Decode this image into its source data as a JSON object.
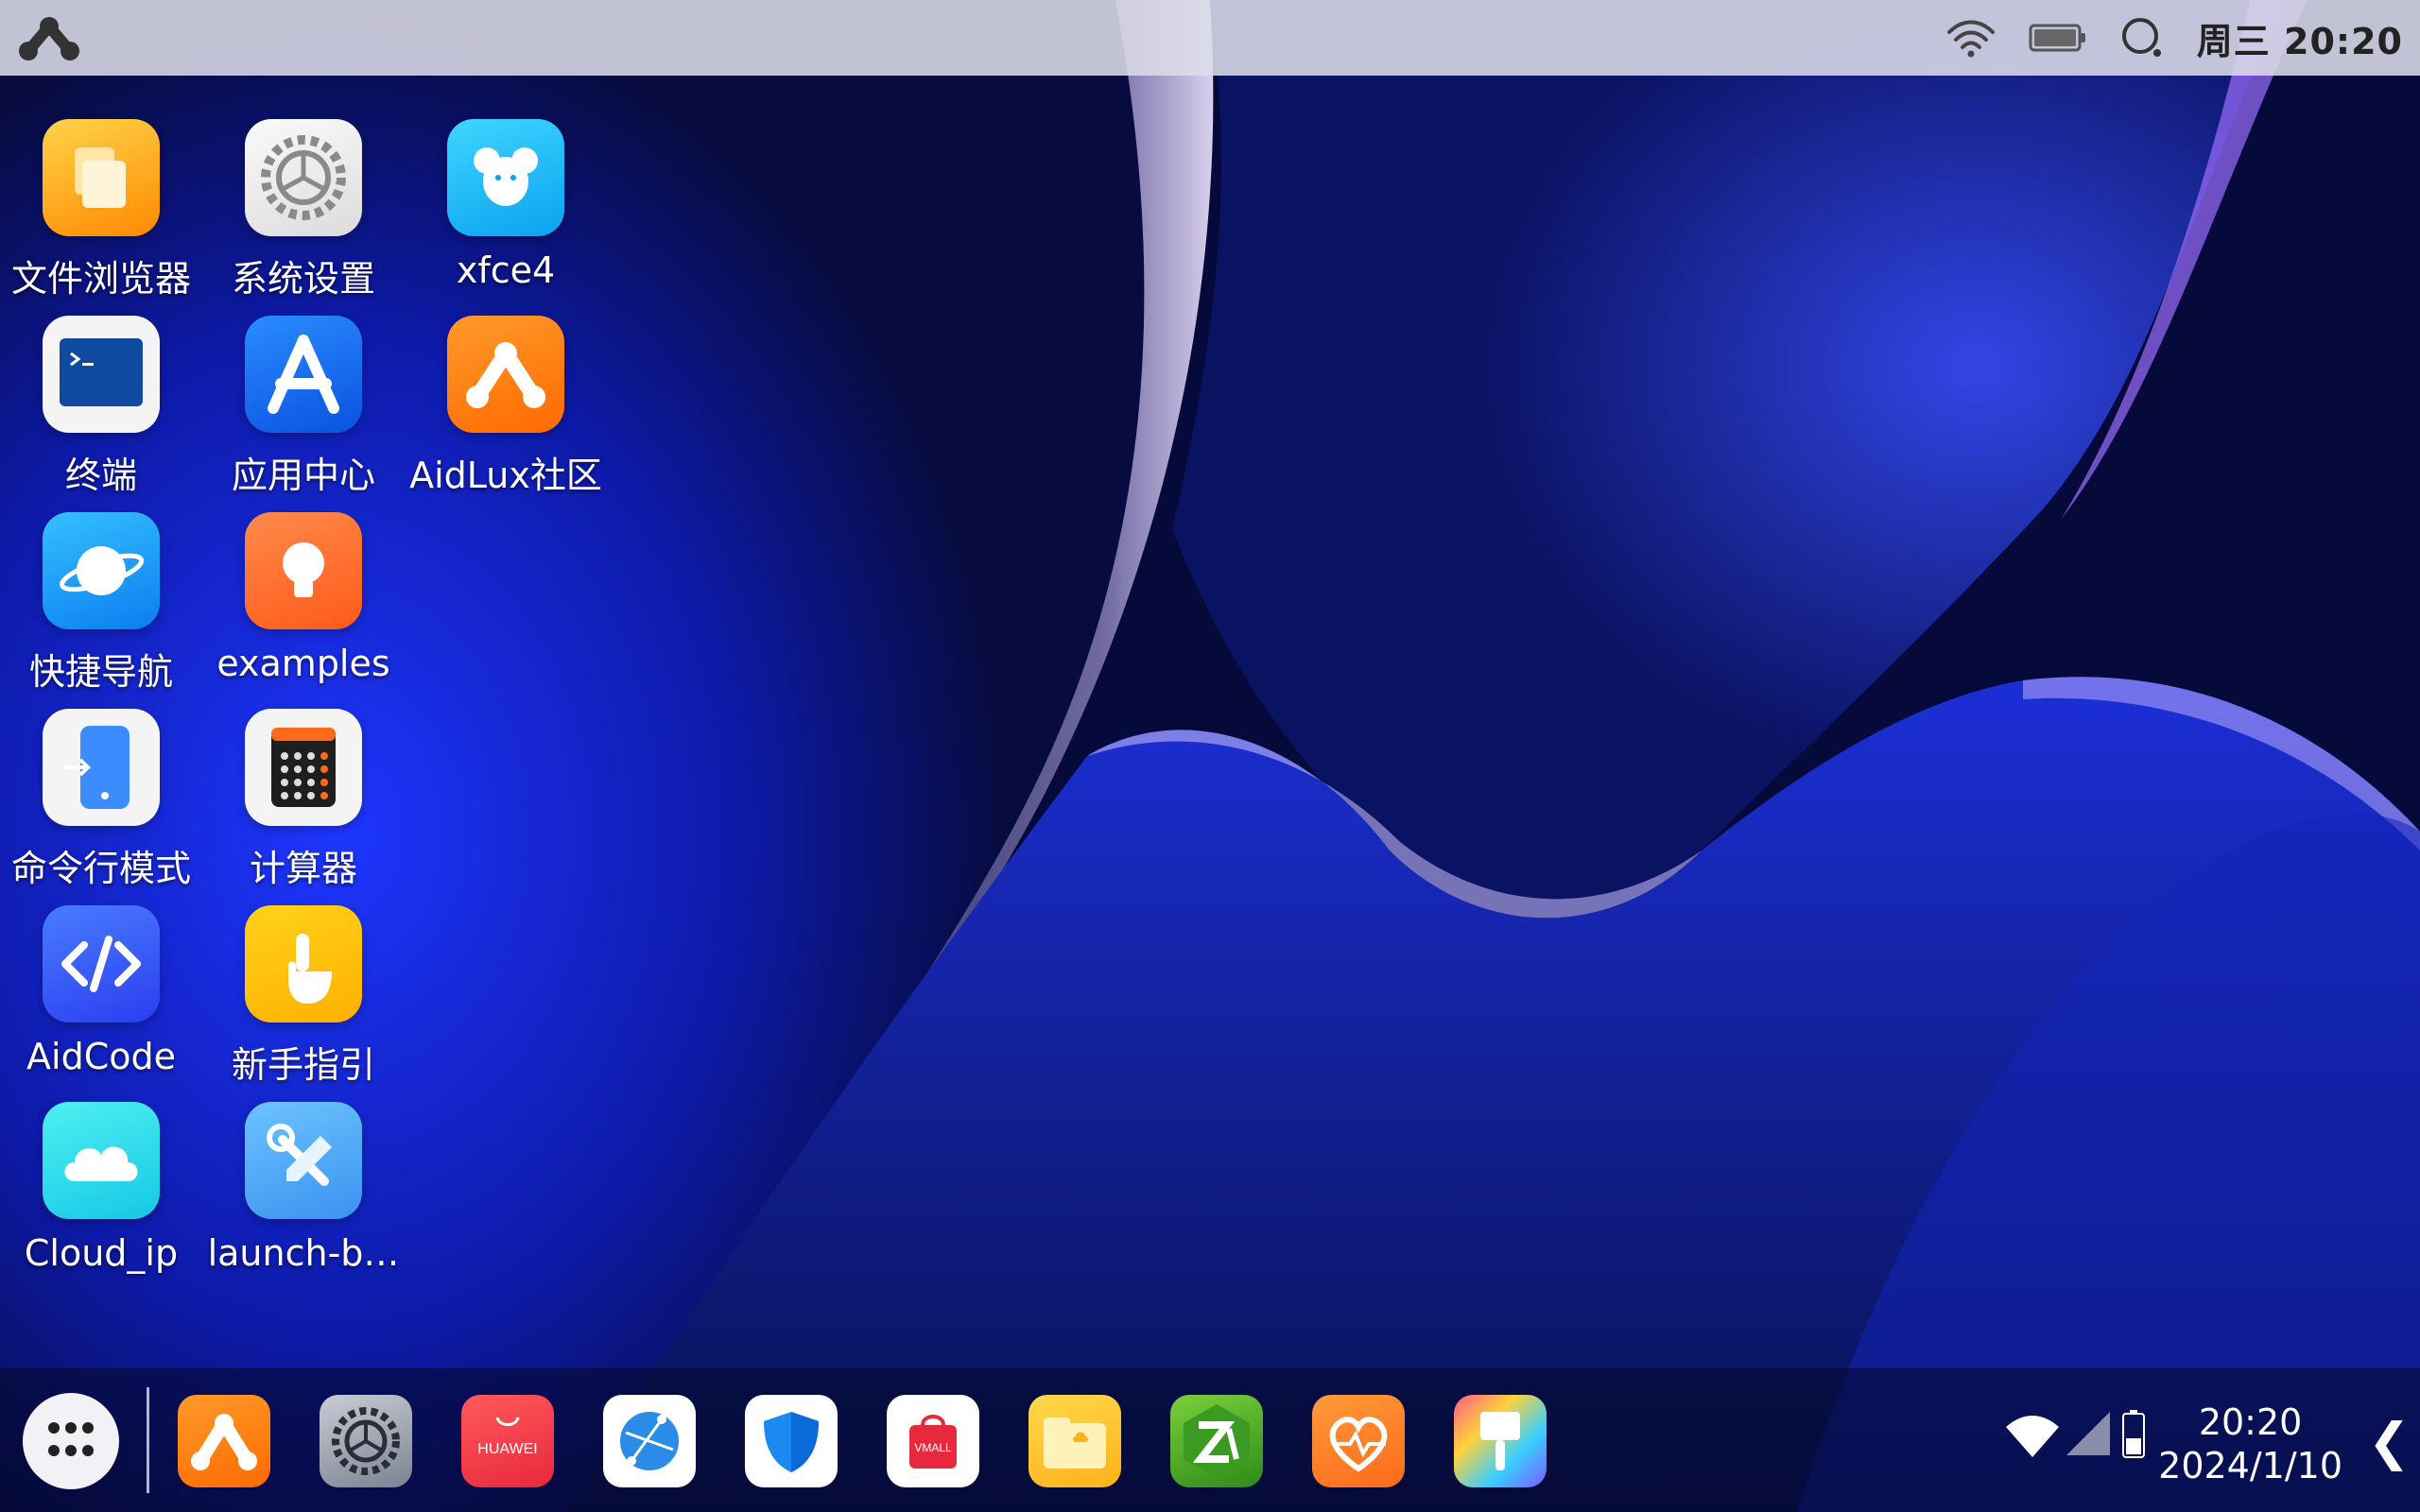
{
  "topbar": {
    "clock": "周三 20:20"
  },
  "desktop": {
    "icons": [
      {
        "label": "文件浏览器",
        "icon": "folder-icon"
      },
      {
        "label": "系统设置",
        "icon": "gear-icon"
      },
      {
        "label": "xfce4",
        "icon": "mouse-icon"
      },
      {
        "label": "终端",
        "icon": "terminal-icon"
      },
      {
        "label": "应用中心",
        "icon": "app-store-icon"
      },
      {
        "label": "AidLux社区",
        "icon": "aidlux-logo-icon"
      },
      {
        "label": "快捷导航",
        "icon": "planet-icon"
      },
      {
        "label": "examples",
        "icon": "lightbulb-icon"
      },
      {
        "label": "命令行模式",
        "icon": "phone-terminal-icon"
      },
      {
        "label": "计算器",
        "icon": "calculator-icon"
      },
      {
        "label": "AidCode",
        "icon": "code-icon"
      },
      {
        "label": "新手指引",
        "icon": "hand-pointer-icon"
      },
      {
        "label": "Cloud_ip",
        "icon": "cloud-icon"
      },
      {
        "label": "launch-b…",
        "icon": "tools-icon"
      }
    ]
  },
  "dock": {
    "apps": [
      {
        "name": "aidlux",
        "icon": "aidlux-logo-icon"
      },
      {
        "name": "settings",
        "icon": "gear-icon"
      },
      {
        "name": "huawei",
        "text": "HUAWEI",
        "icon": "huawei-store-icon"
      },
      {
        "name": "browser",
        "icon": "globe-icon"
      },
      {
        "name": "security",
        "icon": "shield-icon"
      },
      {
        "name": "vmall",
        "text": "VMALL",
        "icon": "shopping-bag-icon"
      },
      {
        "name": "files",
        "icon": "folder-icon"
      },
      {
        "name": "zarchiver",
        "icon": "archive-icon"
      },
      {
        "name": "health",
        "icon": "heart-icon"
      },
      {
        "name": "themes",
        "icon": "paintbrush-icon"
      }
    ],
    "time": "20:20",
    "date": "2024/1/10"
  },
  "colors": {
    "topbar": "#dcdce8",
    "wallpaper_dark": "#060a3a",
    "wallpaper_blue": "#1a3cff"
  }
}
